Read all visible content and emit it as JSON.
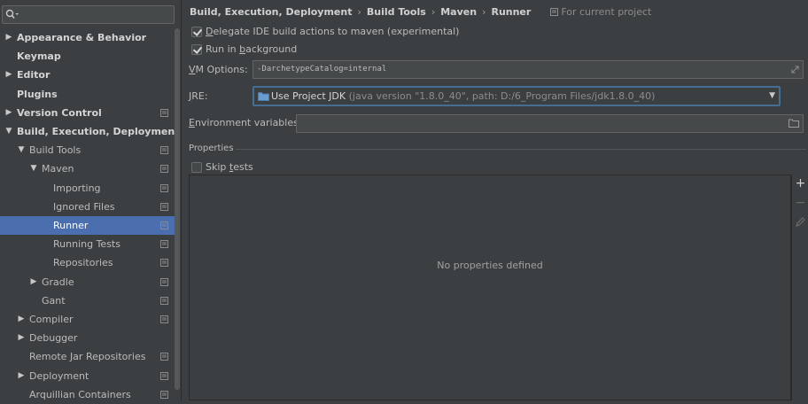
{
  "sidebar": {
    "search": {
      "value": ""
    },
    "items": [
      {
        "label": "Appearance & Behavior",
        "bold": true,
        "arrow": "right",
        "indent": 0,
        "proj": false
      },
      {
        "label": "Keymap",
        "bold": true,
        "arrow": "",
        "indent": 0,
        "proj": false
      },
      {
        "label": "Editor",
        "bold": true,
        "arrow": "right",
        "indent": 0,
        "proj": false
      },
      {
        "label": "Plugins",
        "bold": true,
        "arrow": "",
        "indent": 0,
        "proj": false
      },
      {
        "label": "Version Control",
        "bold": true,
        "arrow": "right",
        "indent": 0,
        "proj": true
      },
      {
        "label": "Build, Execution, Deployment",
        "bold": true,
        "arrow": "down",
        "indent": 0,
        "proj": false
      },
      {
        "label": "Build Tools",
        "bold": false,
        "arrow": "down",
        "indent": 1,
        "proj": true
      },
      {
        "label": "Maven",
        "bold": false,
        "arrow": "down",
        "indent": 2,
        "proj": true
      },
      {
        "label": "Importing",
        "bold": false,
        "arrow": "",
        "indent": 3,
        "proj": true
      },
      {
        "label": "Ignored Files",
        "bold": false,
        "arrow": "",
        "indent": 3,
        "proj": true
      },
      {
        "label": "Runner",
        "bold": false,
        "arrow": "",
        "indent": 3,
        "proj": true,
        "selected": true
      },
      {
        "label": "Running Tests",
        "bold": false,
        "arrow": "",
        "indent": 3,
        "proj": true
      },
      {
        "label": "Repositories",
        "bold": false,
        "arrow": "",
        "indent": 3,
        "proj": true
      },
      {
        "label": "Gradle",
        "bold": false,
        "arrow": "right",
        "indent": 2,
        "proj": true
      },
      {
        "label": "Gant",
        "bold": false,
        "arrow": "",
        "indent": 2,
        "proj": true
      },
      {
        "label": "Compiler",
        "bold": false,
        "arrow": "right",
        "indent": 1,
        "proj": true
      },
      {
        "label": "Debugger",
        "bold": false,
        "arrow": "right",
        "indent": 1,
        "proj": false
      },
      {
        "label": "Remote Jar Repositories",
        "bold": false,
        "arrow": "",
        "indent": 1,
        "proj": true
      },
      {
        "label": "Deployment",
        "bold": false,
        "arrow": "right",
        "indent": 1,
        "proj": true
      },
      {
        "label": "Arquillian Containers",
        "bold": false,
        "arrow": "",
        "indent": 1,
        "proj": true
      }
    ]
  },
  "breadcrumb": {
    "parts": [
      "Build, Execution, Deployment",
      "Build Tools",
      "Maven",
      "Runner"
    ],
    "separator": "›",
    "scope": "For current project"
  },
  "options": {
    "delegate": {
      "label_pre": "",
      "mnemonic": "D",
      "label_post": "elegate IDE build actions to maven (experimental)",
      "checked": true
    },
    "background": {
      "label_pre": "Run in ",
      "mnemonic": "b",
      "label_post": "ackground",
      "checked": true
    },
    "vm": {
      "label_pre": "",
      "mnemonic": "V",
      "label_post": "M Options:",
      "value": "-DarchetypeCatalog=internal"
    },
    "jre": {
      "label_pre": "",
      "mnemonic": "J",
      "label_post": "RE:",
      "value": "Use Project JDK",
      "detail": "(java version \"1.8.0_40\", path: D:/6_Program Files/jdk1.8.0_40)"
    },
    "env": {
      "label_pre": "",
      "mnemonic": "E",
      "label_post": "nvironment variables:",
      "value": ""
    }
  },
  "properties": {
    "title": "Properties",
    "skip_tests": {
      "label_pre": "Skip ",
      "mnemonic": "t",
      "label_post": "ests",
      "checked": false
    },
    "empty_text": "No properties defined",
    "add": "+",
    "remove": "−"
  },
  "colors": {
    "background": "#3c3f41",
    "selection": "#4b6eaf",
    "focus_border": "#466d94"
  }
}
